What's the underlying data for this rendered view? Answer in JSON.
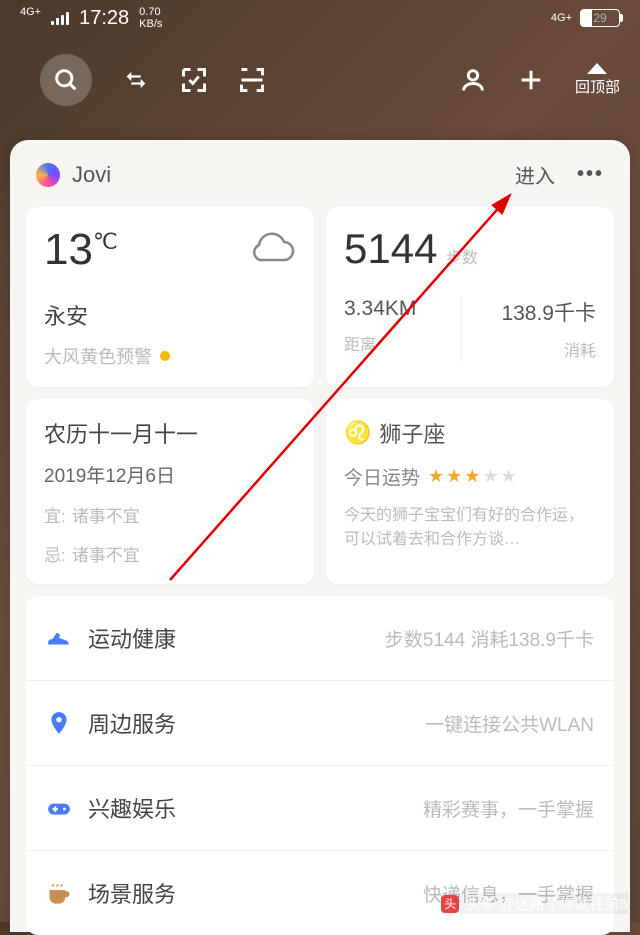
{
  "status": {
    "network": "4G+",
    "time": "17:28",
    "speed_val": "0.70",
    "speed_unit": "KB/s",
    "network_right": "4G+",
    "battery": "29"
  },
  "toolbar": {
    "top_label": "回顶部"
  },
  "panel": {
    "title": "Jovi",
    "enter": "进入"
  },
  "weather": {
    "temp": "13",
    "unit": "℃",
    "city": "永安",
    "warning": "大风黄色预警"
  },
  "steps": {
    "count": "5144",
    "count_label": "步数",
    "distance": "3.34KM",
    "distance_label": "距离",
    "calories": "138.9千卡",
    "calories_label": "消耗"
  },
  "calendar": {
    "lunar": "农历十一月十一",
    "date": "2019年12月6日",
    "yi_label": "宜:",
    "yi": "诸事不宜",
    "ji_label": "忌:",
    "ji": "诸事不宜"
  },
  "horoscope": {
    "sign": "狮子座",
    "sub": "今日运势",
    "desc": "今天的狮子宝宝们有好的合作运，可以试着去和合作方谈…"
  },
  "list": [
    {
      "title": "运动健康",
      "desc": "步数5144 消耗138.9千卡",
      "icon": "shoe",
      "color": "#4a7bff"
    },
    {
      "title": "周边服务",
      "desc": "一键连接公共WLAN",
      "icon": "pin",
      "color": "#4a7bff"
    },
    {
      "title": "兴趣娱乐",
      "desc": "精彩赛事，一手掌握",
      "icon": "game",
      "color": "#4a7bff"
    },
    {
      "title": "场景服务",
      "desc": "快递信息，一手掌握",
      "icon": "cup",
      "color": "#c89050"
    }
  ],
  "watermark": "头条 @迷路了你就往前8"
}
